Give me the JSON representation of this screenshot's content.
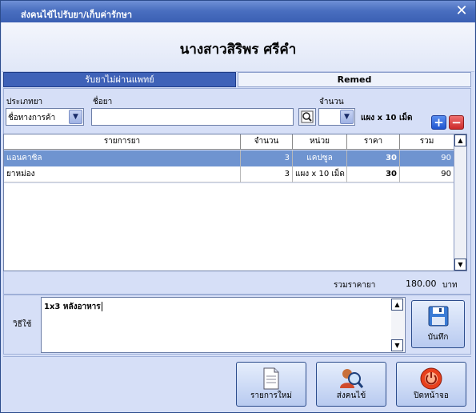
{
  "window": {
    "title": "ส่งคนไข้ไปรับยา/เก็บค่ารักษา",
    "close_glyph": "✕"
  },
  "header": {
    "patient_name": "นางสาวสิริพร ศรีคำ"
  },
  "tabs": [
    {
      "label": "รับยาไม่ผ่านแพทย์",
      "active": true
    },
    {
      "label": "Remed",
      "active": false
    }
  ],
  "form": {
    "drug_type_label": "ประเภทยา",
    "drug_type_value": "ชื่อทางการค้า",
    "drug_name_label": "ชื่อยา",
    "drug_name_value": "",
    "quantity_label": "จำนวน",
    "quantity_value": "",
    "unit_text": "แผง x 10 เม็ด",
    "add_glyph": "+",
    "remove_glyph": "−"
  },
  "table": {
    "columns": [
      "รายการยา",
      "จำนวน",
      "หน่วย",
      "ราคา",
      "รวม"
    ],
    "rows": [
      {
        "name": "แอนคาซิล",
        "qty": "3",
        "unit": "แคปซูล",
        "price": "30",
        "total": "90",
        "selected": true
      },
      {
        "name": "ยาหม่อง",
        "qty": "3",
        "unit": "แผง x 10 เม็ด",
        "price": "30",
        "total": "90",
        "selected": false
      }
    ]
  },
  "total": {
    "label": "รวมราคายา",
    "value": "180.00",
    "unit": "บาท"
  },
  "usage": {
    "label": "วิธีใช้",
    "text": "1x3 หลังอาหาร"
  },
  "buttons": {
    "save": "บันทึก",
    "new_list": "รายการใหม่",
    "send_patient": "ส่งคนไข้",
    "close_screen": "ปิดหน้าจอ"
  },
  "colors": {
    "titlebar": "#3a5fb3",
    "selected_row": "#6f94d0",
    "panel_bg": "#d6dff7"
  }
}
